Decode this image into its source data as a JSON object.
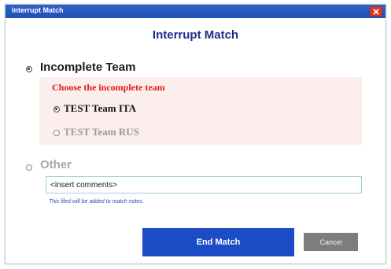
{
  "window": {
    "title": "Interrupt Match",
    "close_icon": "close-icon"
  },
  "dialog": {
    "title": "Interrupt Match"
  },
  "options": {
    "incomplete_team": {
      "label": "Incomplete Team",
      "selected": true
    },
    "other": {
      "label": "Other",
      "selected": false
    }
  },
  "incomplete_panel": {
    "heading": "Choose the incomplete team",
    "teams": [
      {
        "label": "TEST Team ITA",
        "selected": true
      },
      {
        "label": "TEST Team RUS",
        "selected": false
      }
    ]
  },
  "comments": {
    "value": "<insert comments>",
    "hint": "This filed will be added to match notes."
  },
  "buttons": {
    "end_match": "End Match",
    "cancel": "Cancel"
  },
  "colors": {
    "title_bar": "#2457be",
    "title_text": "#1d2b8c",
    "heading_red": "#e01818",
    "primary_button": "#1c4cc6",
    "cancel_button": "#7d7d7d",
    "panel_background": "#fdeeee"
  }
}
